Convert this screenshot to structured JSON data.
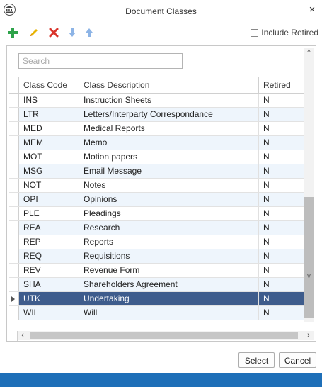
{
  "window": {
    "title": "Document Classes",
    "close": "×"
  },
  "toolbar": {
    "include_retired_label": "Include Retired"
  },
  "search": {
    "placeholder": "Search"
  },
  "grid": {
    "columns": [
      "Class Code",
      "Class Description",
      "Retired"
    ],
    "rows": [
      [
        "INS",
        "Instruction Sheets",
        "N"
      ],
      [
        "LTR",
        "Letters/Interparty Correspondance",
        "N"
      ],
      [
        "MED",
        "Medical Reports",
        "N"
      ],
      [
        "MEM",
        "Memo",
        "N"
      ],
      [
        "MOT",
        "Motion papers",
        "N"
      ],
      [
        "MSG",
        "Email Message",
        "N"
      ],
      [
        "NOT",
        "Notes",
        "N"
      ],
      [
        "OPI",
        "Opinions",
        "N"
      ],
      [
        "PLE",
        "Pleadings",
        "N"
      ],
      [
        "REA",
        "Research",
        "N"
      ],
      [
        "REP",
        "Reports",
        "N"
      ],
      [
        "REQ",
        "Requisitions",
        "N"
      ],
      [
        "REV",
        "Revenue Form",
        "N"
      ],
      [
        "SHA",
        "Shareholders Agreement",
        "N"
      ],
      [
        "UTK",
        "Undertaking",
        "N"
      ],
      [
        "WIL",
        "Will",
        "N"
      ]
    ],
    "selected_index": 14
  },
  "buttons": {
    "select_label": "Select",
    "cancel_label": "Cancel"
  },
  "colors": {
    "selection": "#3e5c8c",
    "status_bar": "#1e6fb8",
    "add": "#2ea34a",
    "delete": "#d9342b"
  },
  "icons": [
    "app-icon",
    "add-icon",
    "edit-icon",
    "delete-icon",
    "move-down-icon",
    "move-up-icon"
  ]
}
